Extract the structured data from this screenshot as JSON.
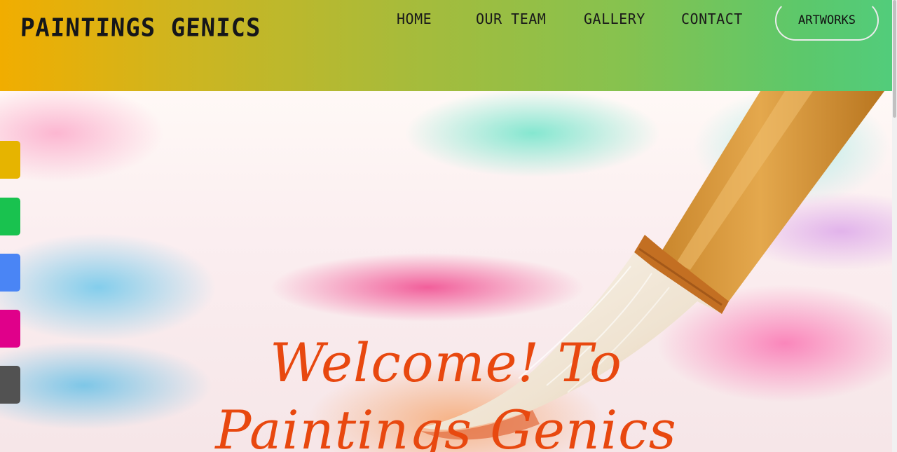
{
  "header": {
    "brand": "PAINTINGS GENICS",
    "nav": {
      "home": "HOME",
      "team": "OUR TEAM",
      "gallery": "GALLERY",
      "contact": "CONTACT"
    },
    "cta_label": "ARTWORKS"
  },
  "hero": {
    "welcome_line1": "Welcome! To",
    "welcome_line2": "Paintings Genics"
  },
  "social_links": [
    {
      "icon": "social-link-icon",
      "color": "#e6b400"
    },
    {
      "icon": "social-link-icon",
      "color": "#19c24f"
    },
    {
      "icon": "social-link-icon",
      "color": "#4a85f5"
    },
    {
      "icon": "social-link-icon",
      "color": "#e0008a"
    },
    {
      "icon": "social-link-icon",
      "color": "#525252"
    }
  ],
  "colors": {
    "header_gradient_start": "#f1ad00",
    "header_gradient_end": "#52cc7b",
    "welcome_text": "#e8480f"
  }
}
